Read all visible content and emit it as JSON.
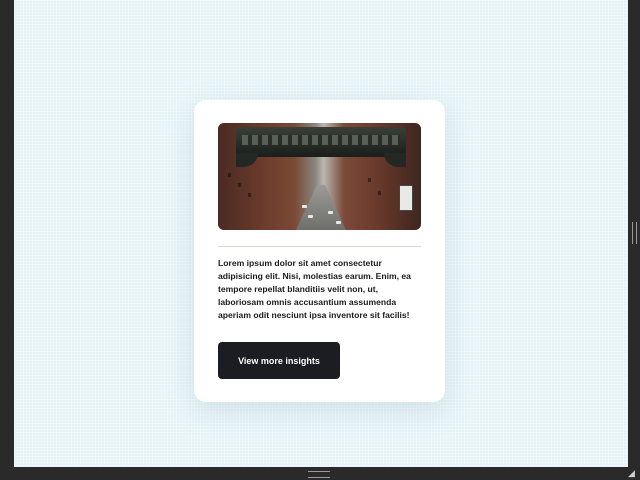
{
  "card": {
    "image_alt": "City street with an overhead bridge between brick buildings",
    "body": "Lorem ipsum dolor sit amet consectetur adipisicing elit. Nisi, molestias earum. Enim, ea tempore repellat blanditiis velit non, ut, laboriosam omnis accusantium assumenda aperiam odit nesciunt ipsa inventore sit facilis!",
    "button_label": "View more insights"
  },
  "icons": {
    "resize": "resize-corner-icon",
    "scroll_right": "scroll-handle-icon",
    "scroll_bottom": "scroll-handle-icon"
  },
  "colors": {
    "page_background": "#e4f3f8",
    "card_background": "#ffffff",
    "button_background": "#1c1d22",
    "button_text": "#ffffff",
    "outer_frame": "#2a2a2a"
  }
}
